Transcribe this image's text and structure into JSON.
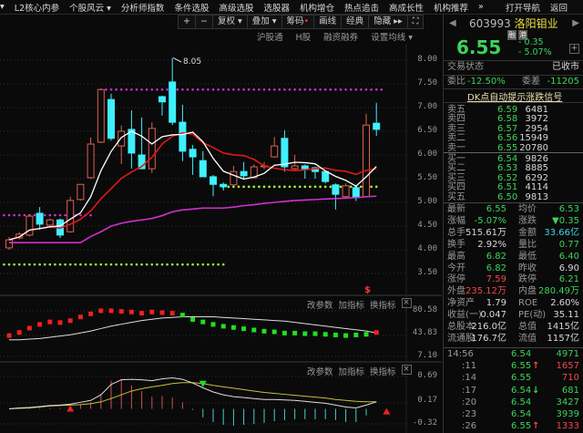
{
  "menu": {
    "items": [
      "▾",
      "L2核心内参",
      "个股风云 ▾",
      "分析师指数",
      "条件选股",
      "高级选股",
      "选股器",
      "机构增仓",
      "热点追击",
      "高成长性",
      "机构推荐",
      "»"
    ],
    "open_nav": "打开导航",
    "back": "返回"
  },
  "toolbar": {
    "items": [
      "+",
      "−",
      "复权 ▾",
      "叠加 ▾",
      "筹码",
      "画线",
      "经典",
      "隐藏 ▸▸",
      "⛶"
    ]
  },
  "subbar": {
    "items": [
      "沪股通",
      "H股",
      "融资融券",
      "设置均线 ▾"
    ]
  },
  "stock": {
    "code": "603993",
    "name": "洛阳钼业",
    "badges": [
      "融",
      "港"
    ],
    "price": "6.55",
    "change": "- 0.35",
    "change_pct": "- 5.07%",
    "add": "+"
  },
  "status": {
    "label": "交易状态",
    "value": "已收市"
  },
  "ratio": {
    "label1": "委比",
    "value1": "-12.50%",
    "label2": "委差",
    "value2": "-11205"
  },
  "banner": "DK点自动提示涨跌信号",
  "sell": [
    {
      "label": "卖五",
      "price": "6.59",
      "vol": "6481"
    },
    {
      "label": "卖四",
      "price": "6.58",
      "vol": "3972"
    },
    {
      "label": "卖三",
      "price": "6.57",
      "vol": "2954"
    },
    {
      "label": "卖二",
      "price": "6.56",
      "vol": "15949"
    },
    {
      "label": "卖一",
      "price": "6.55",
      "vol": "20780"
    }
  ],
  "buy": [
    {
      "label": "买一",
      "price": "6.54",
      "vol": "9826"
    },
    {
      "label": "买二",
      "price": "6.53",
      "vol": "8885"
    },
    {
      "label": "买三",
      "price": "6.52",
      "vol": "6292"
    },
    {
      "label": "买四",
      "price": "6.51",
      "vol": "4114"
    },
    {
      "label": "买五",
      "price": "6.50",
      "vol": "9813"
    }
  ],
  "stats": [
    {
      "l1": "最新",
      "v1": "6.55",
      "c1": "g",
      "l2": "均价",
      "v2": "6.53",
      "c2": "g"
    },
    {
      "l1": "涨幅",
      "v1": "-5.07%",
      "c1": "g",
      "l2": "涨跌",
      "v2": "▼0.35",
      "c2": "g"
    },
    {
      "l1": "总手",
      "v1": "515.61万",
      "c1": "w",
      "l2": "金额",
      "v2": "33.66亿",
      "c2": "c"
    },
    {
      "l1": "换手",
      "v1": "2.92%",
      "c1": "w",
      "l2": "量比",
      "v2": "0.77",
      "c2": "g"
    },
    {
      "l1": "最高",
      "v1": "6.82",
      "c1": "g",
      "l2": "最低",
      "v2": "6.40",
      "c2": "g"
    },
    {
      "l1": "今开",
      "v1": "6.82",
      "c1": "g",
      "l2": "昨收",
      "v2": "6.90",
      "c2": "w"
    },
    {
      "l1": "涨停",
      "v1": "7.59",
      "c1": "r",
      "l2": "跌停",
      "v2": "6.21",
      "c2": "g"
    },
    {
      "l1": "外盘",
      "v1": "235.12万",
      "c1": "r",
      "l2": "内盘",
      "v2": "280.49万",
      "c2": "g"
    },
    {
      "l1": "净资产",
      "v1": "1.79",
      "c1": "w",
      "l2": "ROE",
      "v2": "2.60%",
      "c2": "w"
    },
    {
      "l1": "收益(一)",
      "v1": "0.047",
      "c1": "w",
      "l2": "PE(动)",
      "v2": "35.11",
      "c2": "w"
    },
    {
      "l1": "总股本",
      "v1": "216.0亿",
      "c1": "w",
      "l2": "总值",
      "v2": "1415亿",
      "c2": "w"
    },
    {
      "l1": "流通股",
      "v1": "176.7亿",
      "c1": "w",
      "l2": "流值",
      "v2": "1157亿",
      "c2": "w"
    }
  ],
  "ticks": [
    {
      "time": "14:56",
      "price": "6.54",
      "arrow": "",
      "vol": "4971",
      "vc": "g"
    },
    {
      "time": ":11",
      "price": "6.55",
      "arrow": "↑",
      "vol": "1657",
      "vc": "r"
    },
    {
      "time": ":14",
      "price": "6.55",
      "arrow": "",
      "vol": "710",
      "vc": "r"
    },
    {
      "time": ":17",
      "price": "6.54",
      "arrow": "↓",
      "vol": "681",
      "vc": "g"
    },
    {
      "time": ":20",
      "price": "6.54",
      "arrow": "",
      "vol": "3427",
      "vc": "g"
    },
    {
      "time": ":23",
      "price": "6.54",
      "arrow": "",
      "vol": "3939",
      "vc": "g"
    },
    {
      "time": ":26",
      "price": "6.55",
      "arrow": "↑",
      "vol": "1333",
      "vc": "r"
    }
  ],
  "panel": {
    "edit": "改参数",
    "add": "加指标",
    "switch": "换指标",
    "close": "×"
  },
  "colors": {
    "up": "#e0604f",
    "down": "#3ff0ff",
    "ma5": "#ffffff",
    "ma10": "#e01818",
    "ma_long": "#d030d0"
  },
  "chart_data": {
    "type": "candlestick",
    "price_axis": [
      "8.00",
      "7.50",
      "7.00",
      "6.50",
      "6.00",
      "5.50",
      "5.00",
      "4.50",
      "4.00",
      "3.50"
    ],
    "ylim": [
      3.5,
      8.0
    ],
    "high_label": "8.05",
    "signal_label": "$",
    "candles": [
      [
        4.04,
        4.27,
        4.0,
        4.21
      ],
      [
        4.25,
        4.37,
        4.22,
        4.33
      ],
      [
        4.31,
        4.75,
        4.28,
        4.71
      ],
      [
        4.77,
        4.9,
        4.42,
        4.54
      ],
      [
        4.52,
        4.66,
        4.5,
        4.63
      ],
      [
        4.63,
        4.66,
        4.25,
        4.31
      ],
      [
        4.38,
        5.12,
        4.36,
        5.04
      ],
      [
        5.06,
        5.38,
        5.04,
        5.38
      ],
      [
        5.52,
        6.37,
        5.5,
        6.23
      ],
      [
        6.27,
        7.38,
        6.25,
        7.38
      ],
      [
        7.17,
        7.29,
        6.3,
        6.35
      ],
      [
        6.19,
        6.62,
        5.81,
        6.5
      ],
      [
        6.54,
        6.94,
        5.71,
        6.04
      ],
      [
        6.0,
        6.79,
        5.7,
        5.71
      ],
      [
        5.71,
        6.69,
        5.62,
        6.56
      ],
      [
        7.23,
        7.25,
        6.83,
        7.12
      ],
      [
        7.54,
        8.05,
        6.63,
        6.69
      ],
      [
        6.69,
        7.06,
        5.87,
        6.08
      ],
      [
        6.12,
        6.21,
        5.58,
        5.96
      ],
      [
        5.88,
        6.08,
        5.54,
        5.54
      ],
      [
        5.54,
        5.58,
        5.13,
        5.38
      ],
      [
        5.38,
        5.42,
        5.25,
        5.33
      ],
      [
        5.37,
        5.77,
        5.35,
        5.65
      ],
      [
        5.65,
        5.85,
        5.5,
        5.56
      ],
      [
        5.52,
        5.8,
        5.5,
        5.75
      ],
      [
        5.75,
        5.85,
        5.7,
        5.77
      ],
      [
        5.96,
        6.38,
        5.94,
        6.19
      ],
      [
        6.35,
        6.52,
        5.65,
        5.75
      ],
      [
        5.71,
        6.0,
        5.68,
        5.77
      ],
      [
        5.77,
        5.8,
        5.5,
        5.71
      ],
      [
        5.73,
        5.75,
        5.5,
        5.65
      ],
      [
        5.65,
        5.67,
        5.4,
        5.44
      ],
      [
        5.37,
        5.4,
        4.85,
        5.17
      ],
      [
        5.12,
        5.4,
        5.08,
        5.35
      ],
      [
        5.31,
        5.33,
        5.03,
        5.1
      ],
      [
        5.12,
        6.87,
        5.1,
        6.63
      ],
      [
        6.67,
        7.1,
        6.4,
        6.54
      ]
    ],
    "ma_long": [
      4.15,
      4.15,
      4.15,
      4.15,
      4.15,
      4.15,
      4.15,
      4.15,
      4.28,
      4.38,
      4.5,
      4.56,
      4.6,
      4.63,
      4.66,
      4.72,
      4.8,
      4.84,
      4.86,
      4.88,
      4.88,
      4.88,
      4.9,
      4.93,
      4.95,
      4.98,
      5.0,
      5.02,
      5.04,
      5.05,
      5.06,
      5.07,
      5.08,
      5.09,
      5.1,
      5.12,
      5.13
    ],
    "dotted_levels": [
      {
        "price": 7.38,
        "color": "#d030d0",
        "from": 9,
        "to": 37
      },
      {
        "price": 4.73,
        "color": "#d030d0",
        "from": -1,
        "to": 8
      },
      {
        "price": 3.69,
        "color": "#a0ff40",
        "from": -1,
        "to": 21
      },
      {
        "price": 5.33,
        "color": "#a0ff40",
        "from": 21,
        "to": 36
      }
    ],
    "indicator1": {
      "axis": [
        "80.58",
        "43.83",
        "7.10"
      ],
      "ylim": [
        7.1,
        80.58
      ],
      "line": [
        34,
        34,
        35,
        36,
        38,
        40,
        42,
        45,
        48,
        52,
        56,
        59,
        62,
        65,
        67,
        69,
        70,
        71,
        71,
        71,
        71,
        70,
        69,
        68,
        67,
        66,
        65,
        64,
        62,
        60,
        58,
        56,
        54,
        52,
        50,
        48,
        45
      ],
      "bars": [
        40,
        45,
        52,
        58,
        62,
        61,
        64,
        70,
        75,
        80,
        80,
        79,
        78,
        76,
        78,
        77,
        76,
        -73,
        -66,
        -62,
        -58,
        -55,
        -53,
        -51,
        -49,
        -47,
        -46,
        -44,
        -44,
        -43,
        -43,
        -42,
        -41,
        -40,
        -41,
        -42,
        45
      ]
    },
    "indicator2": {
      "axis": [
        "0.69",
        "0.17",
        "-0.32"
      ],
      "ylim": [
        -0.32,
        0.69
      ],
      "dif": [
        0,
        0.02,
        0.03,
        0.05,
        0.07,
        0.08,
        0.1,
        0.14,
        0.18,
        0.3,
        0.52,
        0.62,
        0.63,
        0.62,
        0.6,
        0.64,
        0.66,
        0.63,
        0.55,
        0.45,
        0.36,
        0.3,
        0.26,
        0.24,
        0.22,
        0.2,
        0.2,
        0.19,
        0.18,
        0.16,
        0.14,
        0.12,
        0.08,
        0.04,
        0.02,
        0.08,
        0.15
      ],
      "dea": [
        0,
        0.01,
        0.02,
        0.04,
        0.06,
        0.07,
        0.08,
        0.09,
        0.11,
        0.15,
        0.22,
        0.3,
        0.38,
        0.43,
        0.47,
        0.5,
        0.54,
        0.56,
        0.56,
        0.54,
        0.5,
        0.47,
        0.44,
        0.41,
        0.38,
        0.35,
        0.33,
        0.31,
        0.29,
        0.27,
        0.25,
        0.23,
        0.2,
        0.18,
        0.16,
        0.15,
        0.15
      ]
    }
  }
}
